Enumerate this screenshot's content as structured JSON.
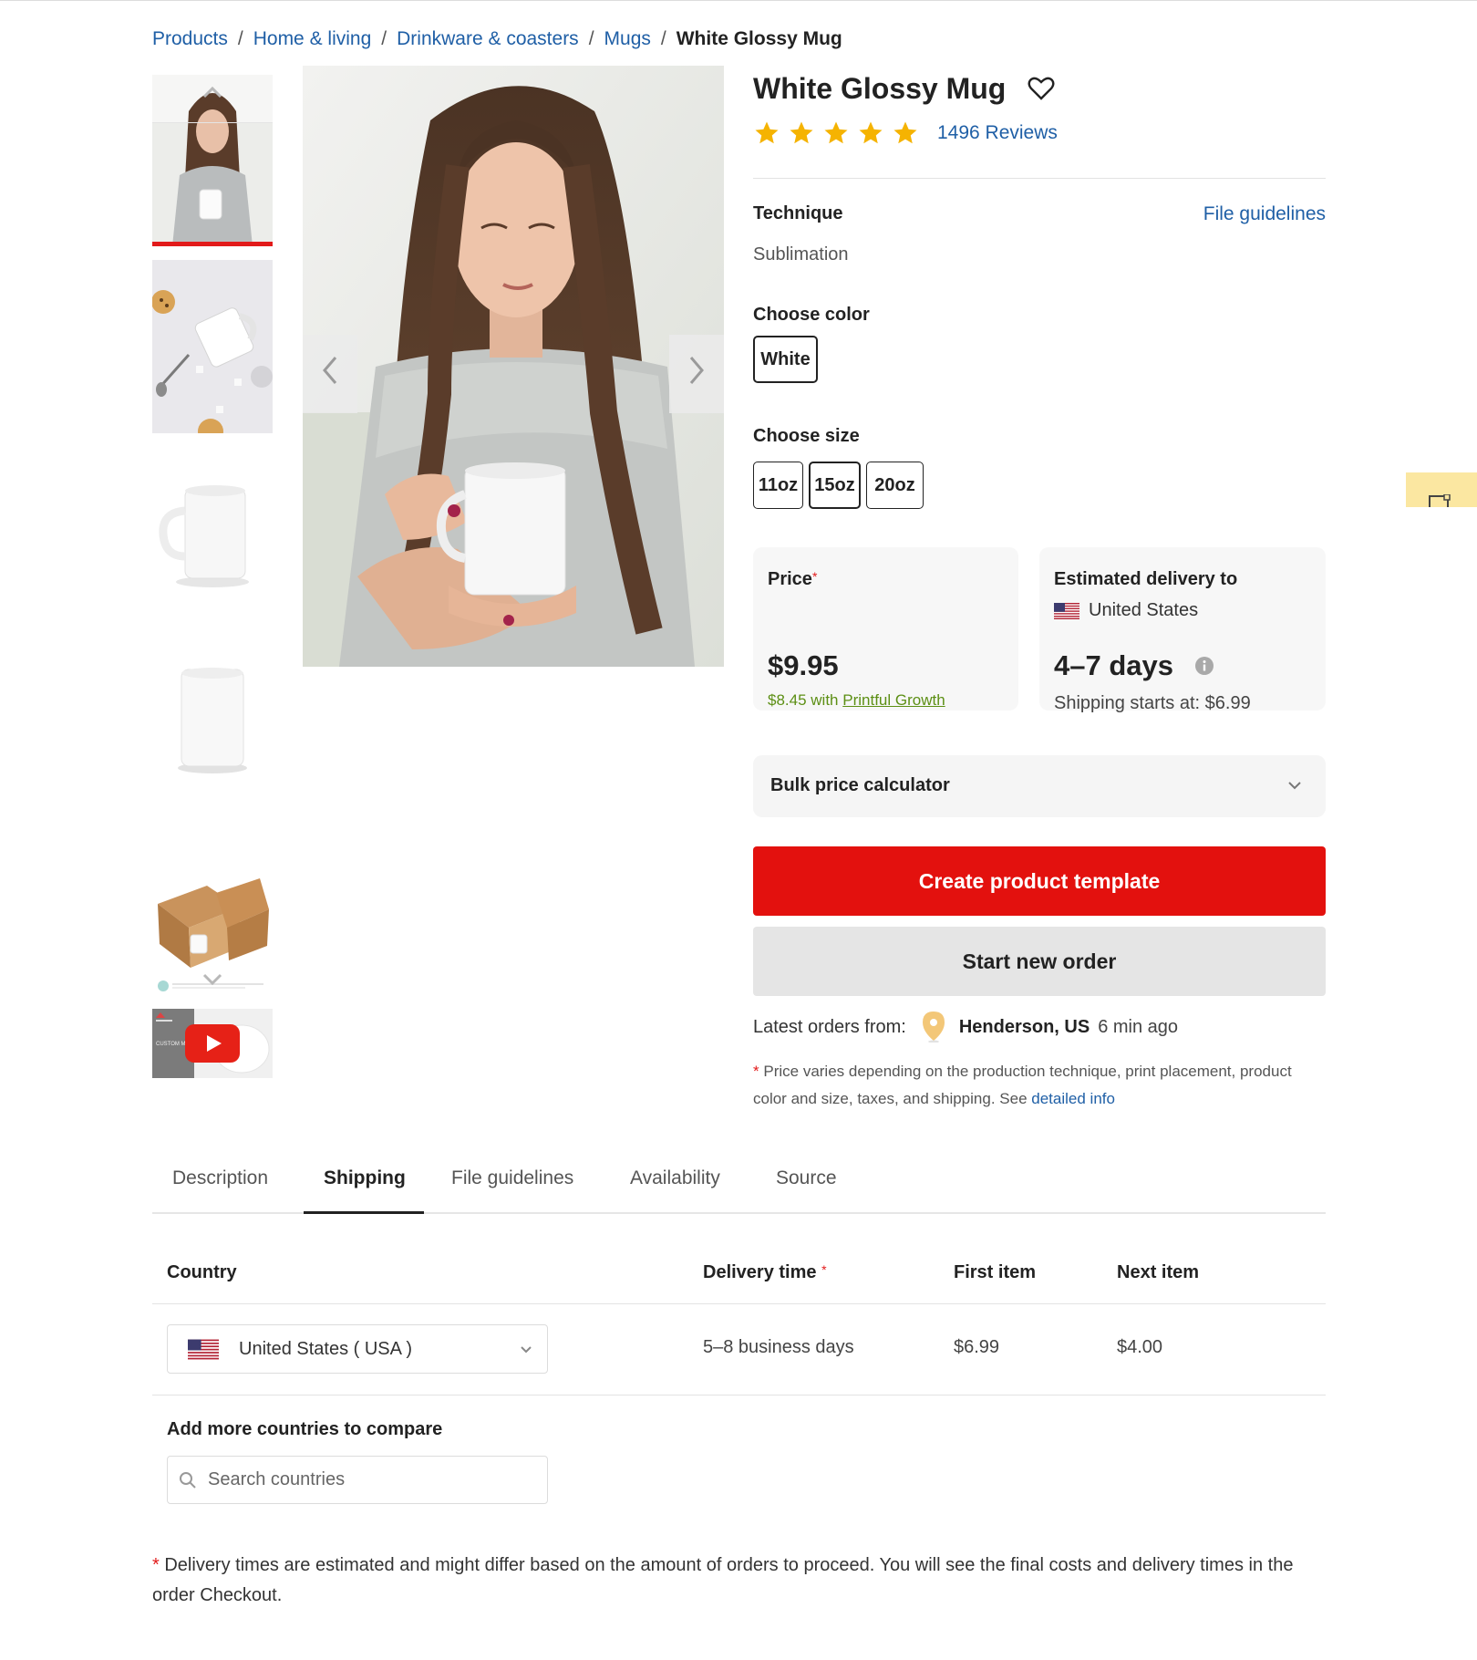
{
  "breadcrumb": {
    "items": [
      "Products",
      "Home & living",
      "Drinkware & coasters",
      "Mugs"
    ],
    "separator": "/",
    "current": "White Glossy Mug"
  },
  "product": {
    "title": "White Glossy Mug",
    "rating": 5,
    "reviews_label": "1496 Reviews"
  },
  "technique": {
    "label": "Technique",
    "value": "Sublimation",
    "link": "File guidelines"
  },
  "color": {
    "label": "Choose color",
    "options": [
      "White"
    ],
    "selected": "White"
  },
  "size": {
    "label": "Choose size",
    "options": [
      "11oz",
      "15oz",
      "20oz"
    ],
    "selected": "15oz"
  },
  "price_card": {
    "label": "Price",
    "required_mark": "*",
    "value": "$9.95",
    "growth_prefix": "$8.45 with",
    "growth_link": "Printful Growth"
  },
  "delivery_card": {
    "label": "Estimated delivery to",
    "country": "United States",
    "days": "4–7 days",
    "shipping_starts": "Shipping starts at: $6.99"
  },
  "bulk": {
    "label": "Bulk price calculator"
  },
  "buttons": {
    "primary": "Create product template",
    "secondary": "Start new order"
  },
  "latest_orders": {
    "label": "Latest orders from:",
    "city": "Henderson, US",
    "time": "6 min ago"
  },
  "footnote": {
    "mark": "*",
    "text": "Price varies depending on the production technique, print placement, product color and size, taxes, and shipping. See",
    "link": "detailed info"
  },
  "tabs": {
    "items": [
      "Description",
      "Shipping",
      "File guidelines",
      "Availability",
      "Source"
    ],
    "active": "Shipping"
  },
  "shipping_table": {
    "headers": {
      "country": "Country",
      "delivery_time": "Delivery time",
      "required_mark": "*",
      "first_item": "First item",
      "next_item": "Next item"
    },
    "row": {
      "country": "United States ( USA )",
      "delivery_time": "5–8 business days",
      "first_item": "$6.99",
      "next_item": "$4.00"
    }
  },
  "compare": {
    "label": "Add more countries to compare",
    "placeholder": "Search countries"
  },
  "bottom_note": {
    "mark": "*",
    "text": "Delivery times are estimated and might differ based on the amount of orders to proceed. You will see the final costs and delivery times in the order Checkout."
  },
  "thumbnails": {
    "video_badge_text": "CUSTOM MUG"
  },
  "colors": {
    "accent_red": "#e3110e",
    "link_blue": "#1f5fa6",
    "star_gold": "#f5b301",
    "growth_green": "#5c8f14"
  }
}
